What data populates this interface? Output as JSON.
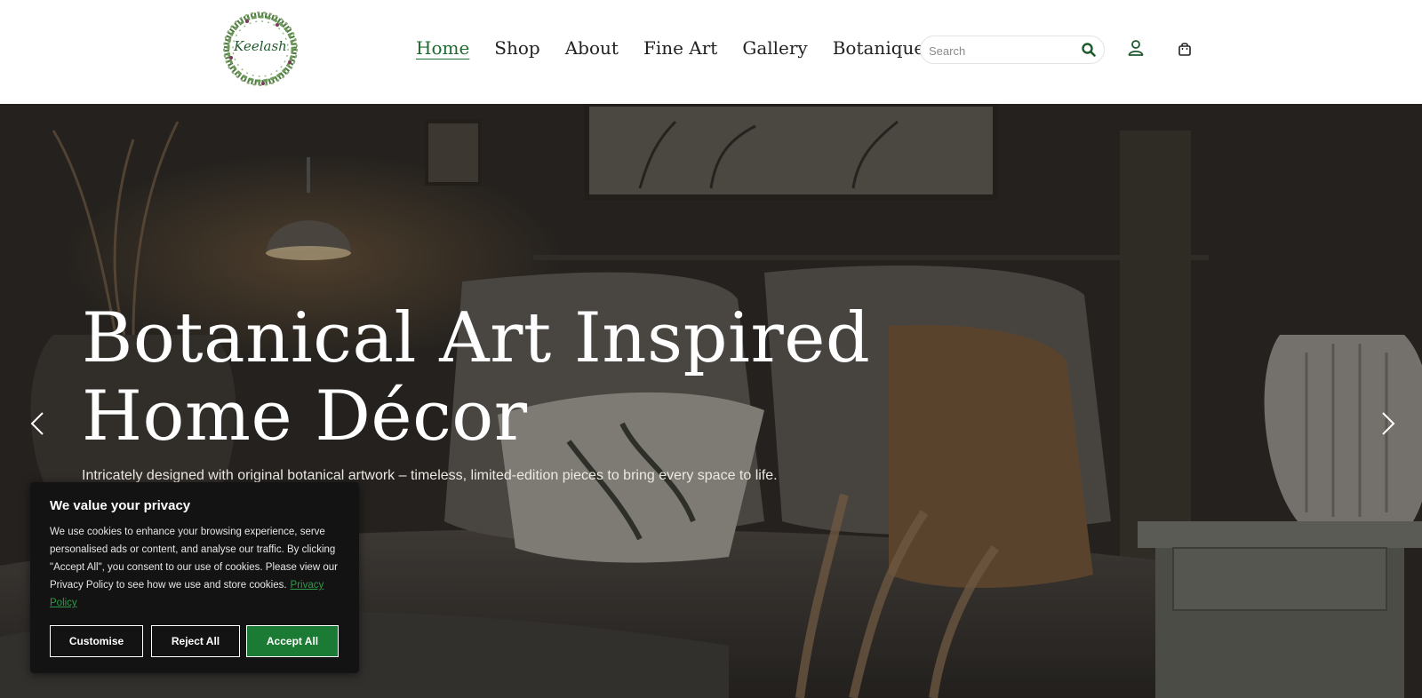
{
  "logo": {
    "text": "Keelash",
    "icon": "wreath-logo"
  },
  "nav": [
    {
      "label": "Home",
      "active": true
    },
    {
      "label": "Shop",
      "active": false
    },
    {
      "label": "About",
      "active": false
    },
    {
      "label": "Fine Art",
      "active": false
    },
    {
      "label": "Gallery",
      "active": false
    },
    {
      "label": "Botanique",
      "active": false
    }
  ],
  "search": {
    "placeholder": "Search",
    "value": "",
    "icon": "search-icon"
  },
  "header_icons": {
    "account": "user-icon",
    "cart": "shopping-bag-icon"
  },
  "hero": {
    "title": "Botanical Art Inspired Home Décor",
    "subtitle": "Intricately designed with original botanical artwork – timeless, limited-edition pieces to bring every space to life.",
    "prev_icon": "chevron-left-icon",
    "next_icon": "chevron-right-icon"
  },
  "cookie": {
    "title": "We value your privacy",
    "text": "We use cookies to enhance your browsing experience, serve personalised ads or content, and analyse our traffic. By clicking \"Accept All\", you consent to our use of cookies. Please view our Privacy Policy to see how we use and store cookies.",
    "link": "Privacy Policy",
    "customise": "Customise",
    "reject": "Reject All",
    "accept": "Accept All"
  },
  "colors": {
    "accent": "#1e6b2f",
    "accept_button": "#1b7a33",
    "cookie_bg": "#131313"
  }
}
